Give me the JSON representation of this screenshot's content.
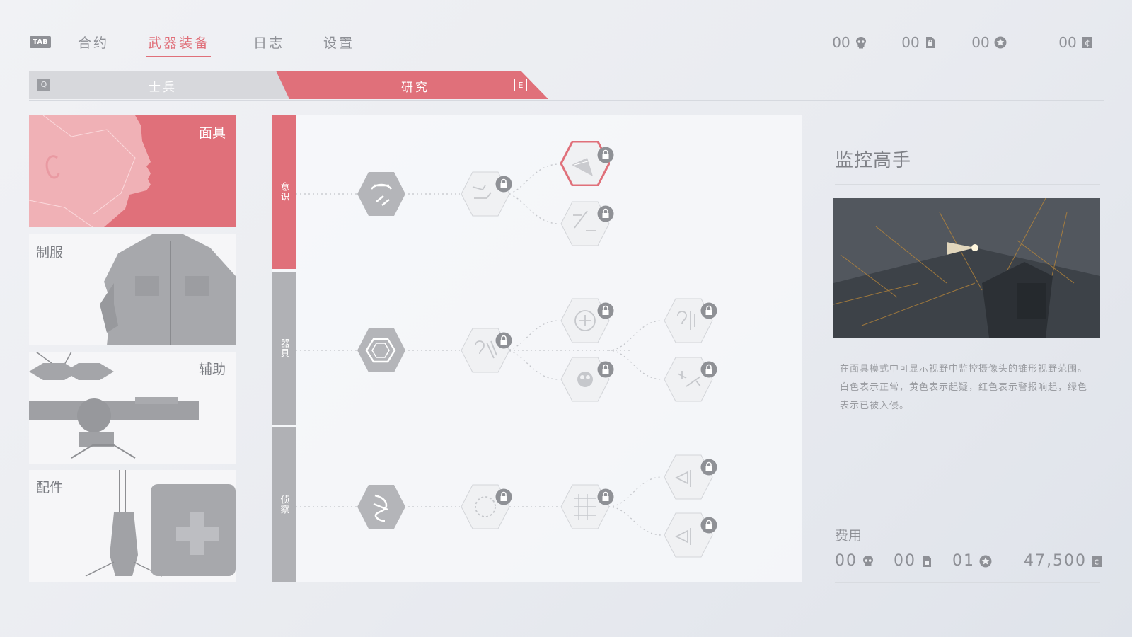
{
  "nav": {
    "tab_key": "TAB",
    "tabs": [
      {
        "label": "合约"
      },
      {
        "label": "武器装备"
      },
      {
        "label": "日志"
      },
      {
        "label": "设置"
      }
    ]
  },
  "currency": [
    {
      "value": "00",
      "icon": "skull-icon"
    },
    {
      "value": "00",
      "icon": "document-lock-icon"
    },
    {
      "value": "00",
      "icon": "star-badge-icon"
    },
    {
      "value": "00",
      "icon": "credits-icon"
    }
  ],
  "subtabs": {
    "q_key": "Q",
    "soldier_label": "士兵",
    "research_label": "研究",
    "e_key": "E"
  },
  "categories": [
    {
      "label": "面具"
    },
    {
      "label": "制服"
    },
    {
      "label": "辅助"
    },
    {
      "label": "配件"
    }
  ],
  "branches": [
    {
      "label": "意识"
    },
    {
      "label": "器具"
    },
    {
      "label": "侦察"
    }
  ],
  "detail": {
    "title": "监控高手",
    "description": "在面具模式中可显示视野中监控摄像头的锥形视野范围。白色表示正常，黄色表示起疑，红色表示警报响起，绿色表示已被入侵。",
    "cost_label": "费用",
    "costs": [
      {
        "value": "00",
        "icon": "skull-icon"
      },
      {
        "value": "00",
        "icon": "document-lock-icon"
      },
      {
        "value": "01",
        "icon": "star-badge-icon"
      },
      {
        "value": "47,500",
        "icon": "credits-icon"
      }
    ]
  },
  "colors": {
    "accent": "#e0707a",
    "text": "#8e9096",
    "inactive_branch": "#b0b1b5"
  }
}
